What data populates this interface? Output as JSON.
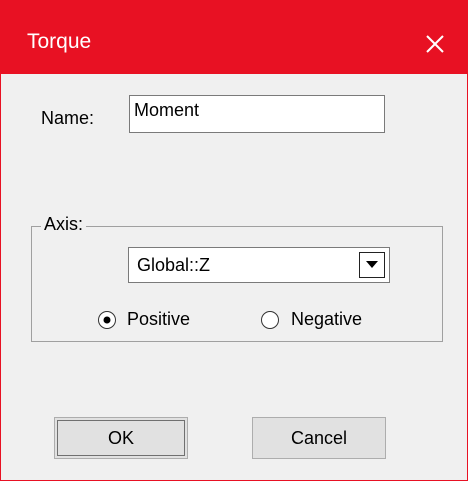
{
  "window": {
    "title": "Torque",
    "accent_color": "#e81123",
    "close_icon": "close-icon"
  },
  "name_field": {
    "label": "Name:",
    "value": "Moment"
  },
  "axis_group": {
    "label": "Axis:",
    "dropdown": {
      "selected": "Global::Z",
      "icon": "chevron-down-icon"
    },
    "direction": {
      "options": [
        {
          "label": "Positive",
          "checked": true
        },
        {
          "label": "Negative",
          "checked": false
        }
      ]
    }
  },
  "buttons": {
    "ok_label": "OK",
    "cancel_label": "Cancel"
  }
}
